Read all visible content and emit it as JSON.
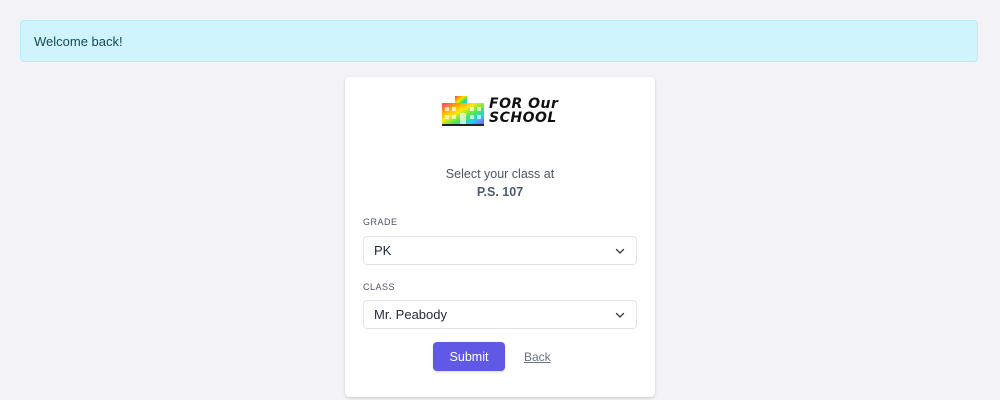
{
  "alert": {
    "message": "Welcome back!",
    "color": "#cff4fb"
  },
  "logo": {
    "line1": "FOR Our",
    "line2": "SCHOOL",
    "icon": "rainbow-school-building-icon"
  },
  "intro": {
    "line1": "Select your class at",
    "school": "P.S. 107"
  },
  "grade": {
    "label": "GRADE",
    "value": "PK"
  },
  "class": {
    "label": "CLASS",
    "value": "Mr. Peabody"
  },
  "actions": {
    "submit_label": "Submit",
    "back_label": "Back",
    "accent": "#6059e6"
  }
}
